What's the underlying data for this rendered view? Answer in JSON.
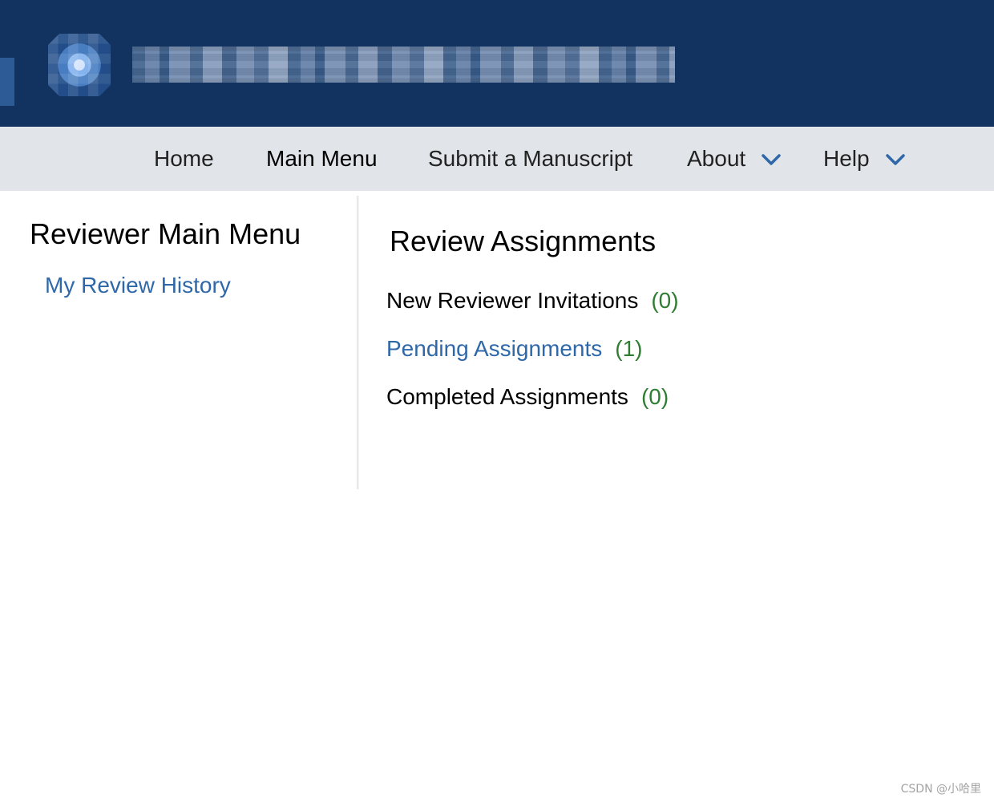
{
  "header": {
    "logo_icon": "logo-icon",
    "title_redacted": true
  },
  "nav": {
    "items": [
      {
        "label": "Home",
        "current": false
      },
      {
        "label": "Main Menu",
        "current": true
      },
      {
        "label": "Submit a Manuscript",
        "current": false
      },
      {
        "label": "About",
        "current": false,
        "dropdown": true
      },
      {
        "label": "Help",
        "current": false,
        "dropdown": true
      }
    ],
    "dropdown_icon": "chevron-down-icon",
    "accent_color": "#2f68a8",
    "background_color": "#e1e5e9"
  },
  "sidebar": {
    "title": "Reviewer Main Menu",
    "links": [
      {
        "label": "My Review History"
      }
    ]
  },
  "review": {
    "title": "Review Assignments",
    "items": [
      {
        "label": "New Reviewer Invitations",
        "count": "(0)",
        "link": false
      },
      {
        "label": "Pending Assignments",
        "count": "(1)",
        "link": true
      },
      {
        "label": "Completed Assignments",
        "count": "(0)",
        "link": false
      }
    ]
  },
  "colors": {
    "header": "#12335f",
    "link": "#2f68a8",
    "count": "#2f7d32",
    "text": "#000000"
  },
  "watermark": {
    "text": "CSDN @小哈里"
  }
}
